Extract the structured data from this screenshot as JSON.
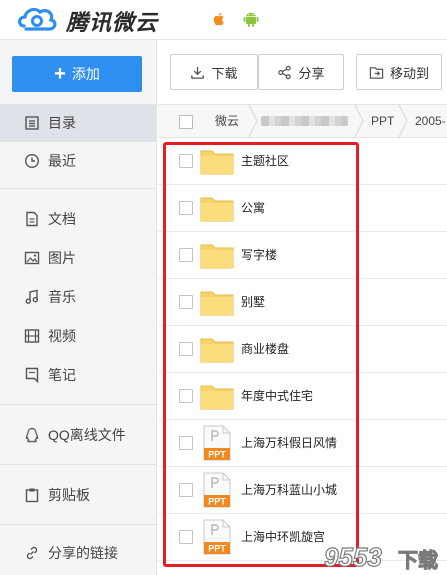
{
  "header": {
    "brand": "腾讯微云",
    "logo_icon": "weiyun-cloud-logo",
    "os_icons": [
      "apple-icon",
      "android-icon"
    ]
  },
  "sidebar": {
    "add_label": "添加",
    "items": [
      {
        "label": "目录",
        "icon": "catalog-icon",
        "active": true
      },
      {
        "label": "最近",
        "icon": "clock-icon"
      },
      {
        "label": "文档",
        "icon": "document-icon"
      },
      {
        "label": "图片",
        "icon": "image-icon"
      },
      {
        "label": "音乐",
        "icon": "music-icon"
      },
      {
        "label": "视频",
        "icon": "video-icon"
      },
      {
        "label": "笔记",
        "icon": "note-icon"
      },
      {
        "label": "QQ离线文件",
        "icon": "qq-icon"
      },
      {
        "label": "剪贴板",
        "icon": "clipboard-icon"
      },
      {
        "label": "分享的链接",
        "icon": "link-icon"
      }
    ]
  },
  "toolbar": {
    "download_label": "下载",
    "share_label": "分享",
    "move_label": "移动到"
  },
  "breadcrumb": {
    "root": "微云",
    "folder": "PPT",
    "current": "2005-"
  },
  "files": [
    {
      "name": "主题社区",
      "type": "folder"
    },
    {
      "name": "公寓",
      "type": "folder"
    },
    {
      "name": "写字楼",
      "type": "folder"
    },
    {
      "name": "别墅",
      "type": "folder"
    },
    {
      "name": "商业楼盘",
      "type": "folder"
    },
    {
      "name": "年度中式住宅",
      "type": "folder"
    },
    {
      "name": "上海万科假日风情",
      "type": "ppt"
    },
    {
      "name": "上海万科蓝山小城",
      "type": "ppt"
    },
    {
      "name": "上海中环凯旋宫",
      "type": "ppt"
    }
  ],
  "ppt_badge": "PPT",
  "watermark": {
    "text": "9553",
    "suffix": "下载"
  },
  "colors": {
    "accent": "#2e8ff0",
    "highlight": "#e02025",
    "folder": "#f7d46b",
    "ppt_badge": "#f0891f"
  }
}
